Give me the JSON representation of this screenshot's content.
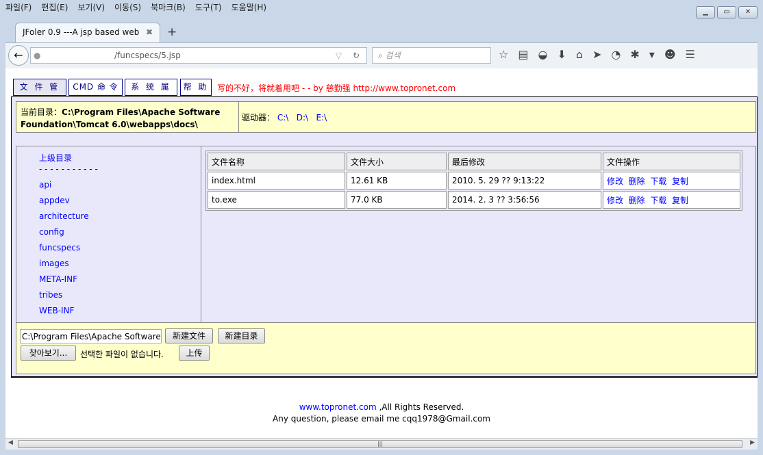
{
  "browser": {
    "menu": [
      "파일(F)",
      "편집(E)",
      "보기(V)",
      "이동(S)",
      "북마크(B)",
      "도구(T)",
      "도움말(H)"
    ],
    "tab_title": "JFoler 0.9 ---A jsp based web ...",
    "url": "/funcspecs/5.jsp",
    "search_placeholder": "검색"
  },
  "nav_tabs": [
    "文 件 管 理",
    "CMD 命 令",
    "系 统 属 性",
    "帮 助"
  ],
  "slogan": "写的不好，将就着用吧 - - by 慈勤强 http://www.topronet.com",
  "info": {
    "current_dir_label": "当前目录：",
    "current_dir": "C:\\Program Files\\Apache Software Foundation\\Tomcat 6.0\\webapps\\docs\\",
    "drives_label": "驱动器：",
    "drives": [
      "C:\\",
      "D:\\",
      "E:\\"
    ]
  },
  "dirs": {
    "parent": "上级目录",
    "separator": "- - - - - - - - - - -",
    "items": [
      "api",
      "appdev",
      "architecture",
      "config",
      "funcspecs",
      "images",
      "META-INF",
      "tribes",
      "WEB-INF"
    ]
  },
  "files": {
    "headers": [
      "文件名称",
      "文件大小",
      "最后修改",
      "文件操作"
    ],
    "actions": [
      "修改",
      "删除",
      "下载",
      "复制"
    ],
    "rows": [
      {
        "name": "index.html",
        "size": "12.61 KB",
        "modified": "2010. 5. 29 ?? 9:13:22"
      },
      {
        "name": "to.exe",
        "size": "77.0 KB",
        "modified": "2014. 2. 3 ?? 3:56:56"
      }
    ]
  },
  "bottom": {
    "path_value": "C:\\Program Files\\Apache Software Fo",
    "new_file": "新建文件",
    "new_dir": "新建目录",
    "browse": "찾아보기...",
    "no_file": "선택한 파일이 없습니다.",
    "upload": "上传"
  },
  "footer": {
    "link": "www.topronet.com",
    "rights": " ,All Rights Reserved.",
    "email_line": "Any question, please email me cqq1978@Gmail.com"
  }
}
